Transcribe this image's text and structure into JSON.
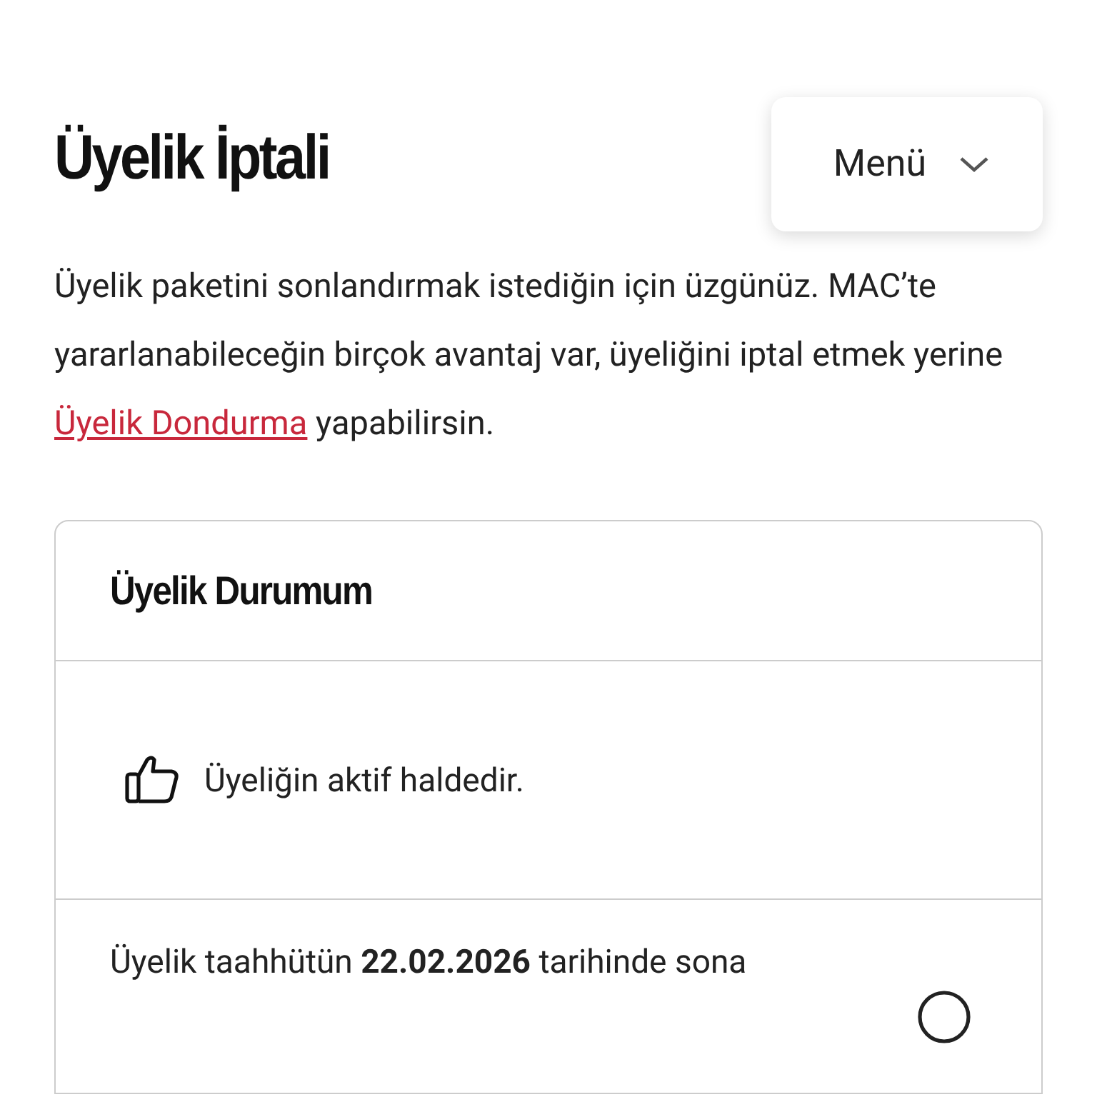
{
  "header": {
    "title": "Üyelik İptali",
    "menu_button": "Menü"
  },
  "intro": {
    "before_link": "Üyelik paketini sonlandırmak istediğin için üzgünüz. MAC’te yararlanabileceğin birçok avantaj var, üyeliğini iptal etmek yerine",
    "link": "Üyelik Dondurma",
    "after_link": "yapabilirsin."
  },
  "status_card": {
    "title": "Üyelik Durumum",
    "status": "Üyeliğin aktif haldedir.",
    "notice": "Üyelik taahhütün **22.02.2026** tarihinde sona"
  }
}
